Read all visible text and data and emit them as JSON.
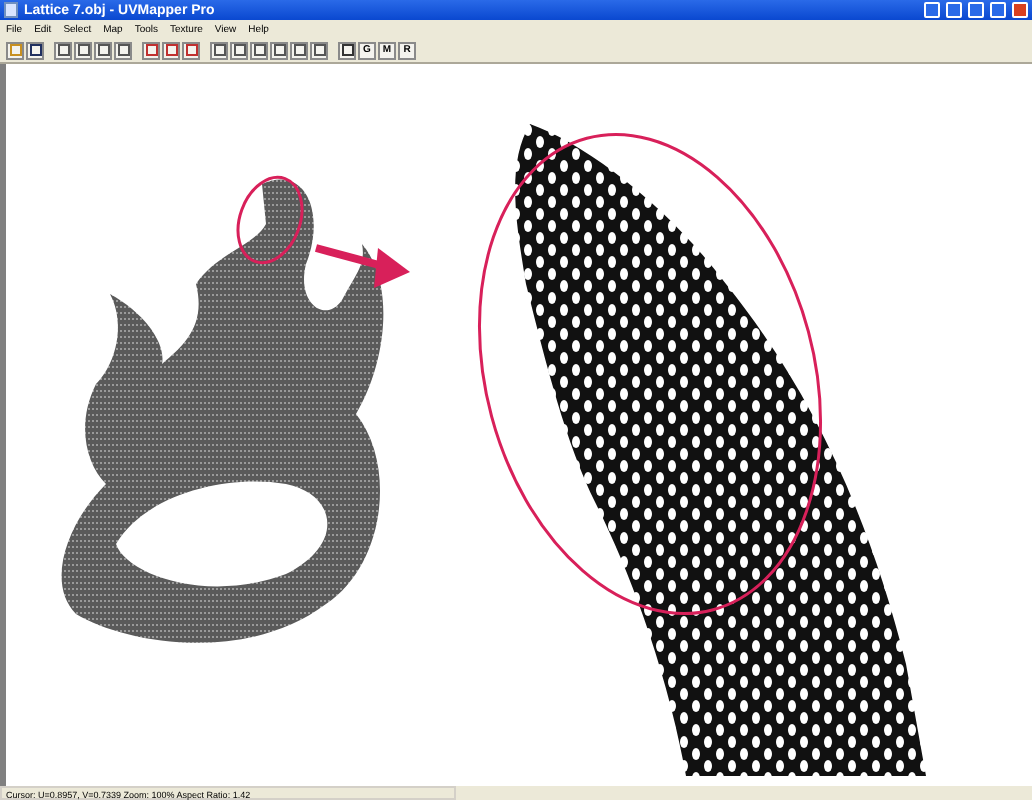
{
  "window": {
    "title": "Lattice 7.obj - UVMapper Pro"
  },
  "menu": [
    "File",
    "Edit",
    "Select",
    "Map",
    "Tools",
    "Texture",
    "View",
    "Help"
  ],
  "toolbar": [
    {
      "kind": "icon"
    },
    {
      "kind": "icon"
    },
    {
      "kind": "sep"
    },
    {
      "kind": "icon"
    },
    {
      "kind": "icon"
    },
    {
      "kind": "icon"
    },
    {
      "kind": "icon"
    },
    {
      "kind": "sep"
    },
    {
      "kind": "icon"
    },
    {
      "kind": "icon"
    },
    {
      "kind": "icon"
    },
    {
      "kind": "sep"
    },
    {
      "kind": "icon"
    },
    {
      "kind": "icon"
    },
    {
      "kind": "icon"
    },
    {
      "kind": "icon"
    },
    {
      "kind": "icon"
    },
    {
      "kind": "icon"
    },
    {
      "kind": "sep"
    },
    {
      "kind": "icon"
    },
    {
      "kind": "text",
      "label": "G"
    },
    {
      "kind": "text",
      "label": "M"
    },
    {
      "kind": "text",
      "label": "R"
    }
  ],
  "status_bar": "Cursor: U=0.8957, V=0.7339  Zoom: 100%  Aspect Ratio: 1.42"
}
